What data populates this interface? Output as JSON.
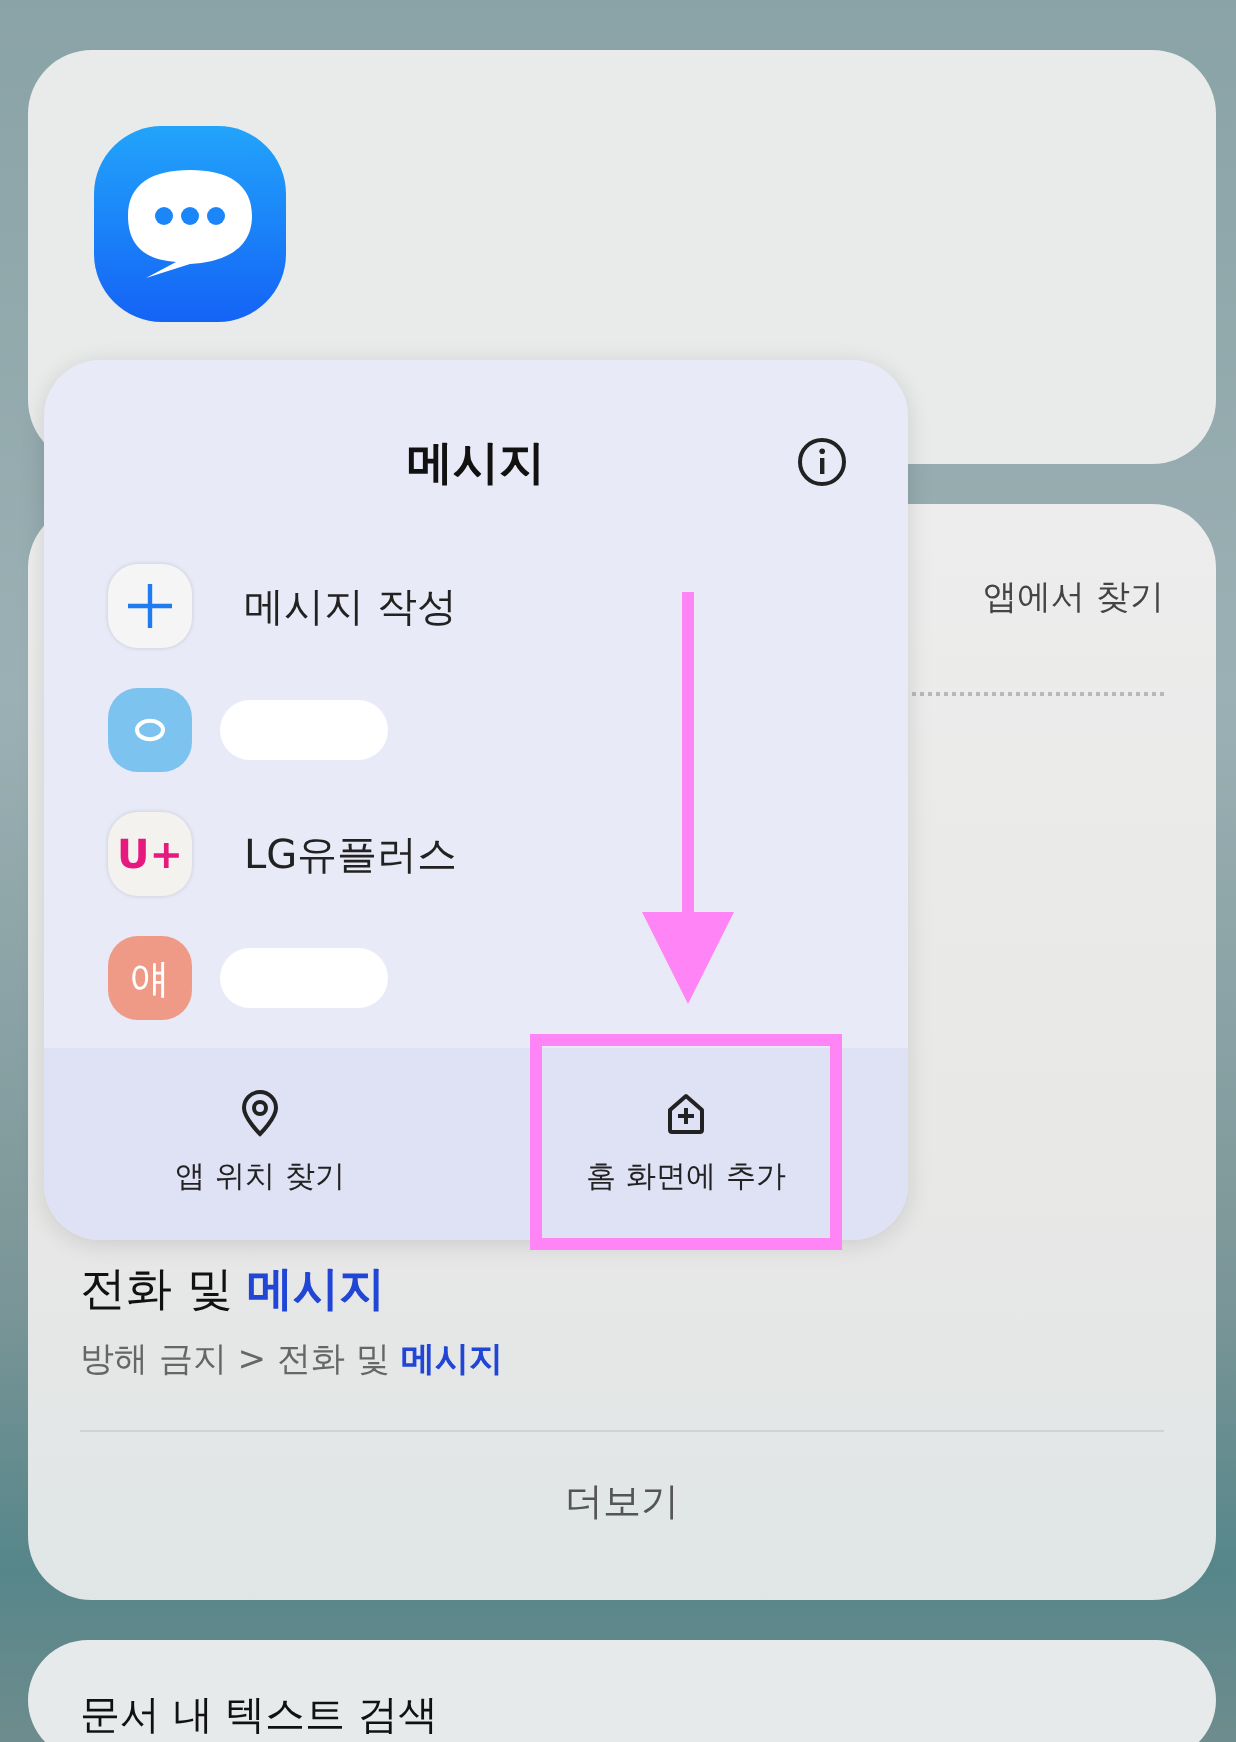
{
  "popup": {
    "title": "메시지",
    "shortcuts": [
      {
        "kind": "compose",
        "label": "메시지 작성"
      },
      {
        "kind": "redacted",
        "color": "#7cc3f0"
      },
      {
        "kind": "logo",
        "icon_text": "U+",
        "label": "LG유플러스",
        "color": "#f4f2ee"
      },
      {
        "kind": "redacted",
        "icon_text": "얘",
        "color": "#ee9a86"
      }
    ],
    "actions": [
      {
        "kind": "location",
        "label": "앱 위치 찾기",
        "highlighted": false
      },
      {
        "kind": "add_home",
        "label": "홈 화면에 추가",
        "highlighted": true
      }
    ]
  },
  "results": {
    "link": "앱에서 찾기",
    "title": "전화 및 **메시지**",
    "path": "방해 금지 > 전화 및 **메시지**",
    "more": "더보기"
  },
  "next_card": {
    "title": "문서 내 텍스트 검색"
  }
}
